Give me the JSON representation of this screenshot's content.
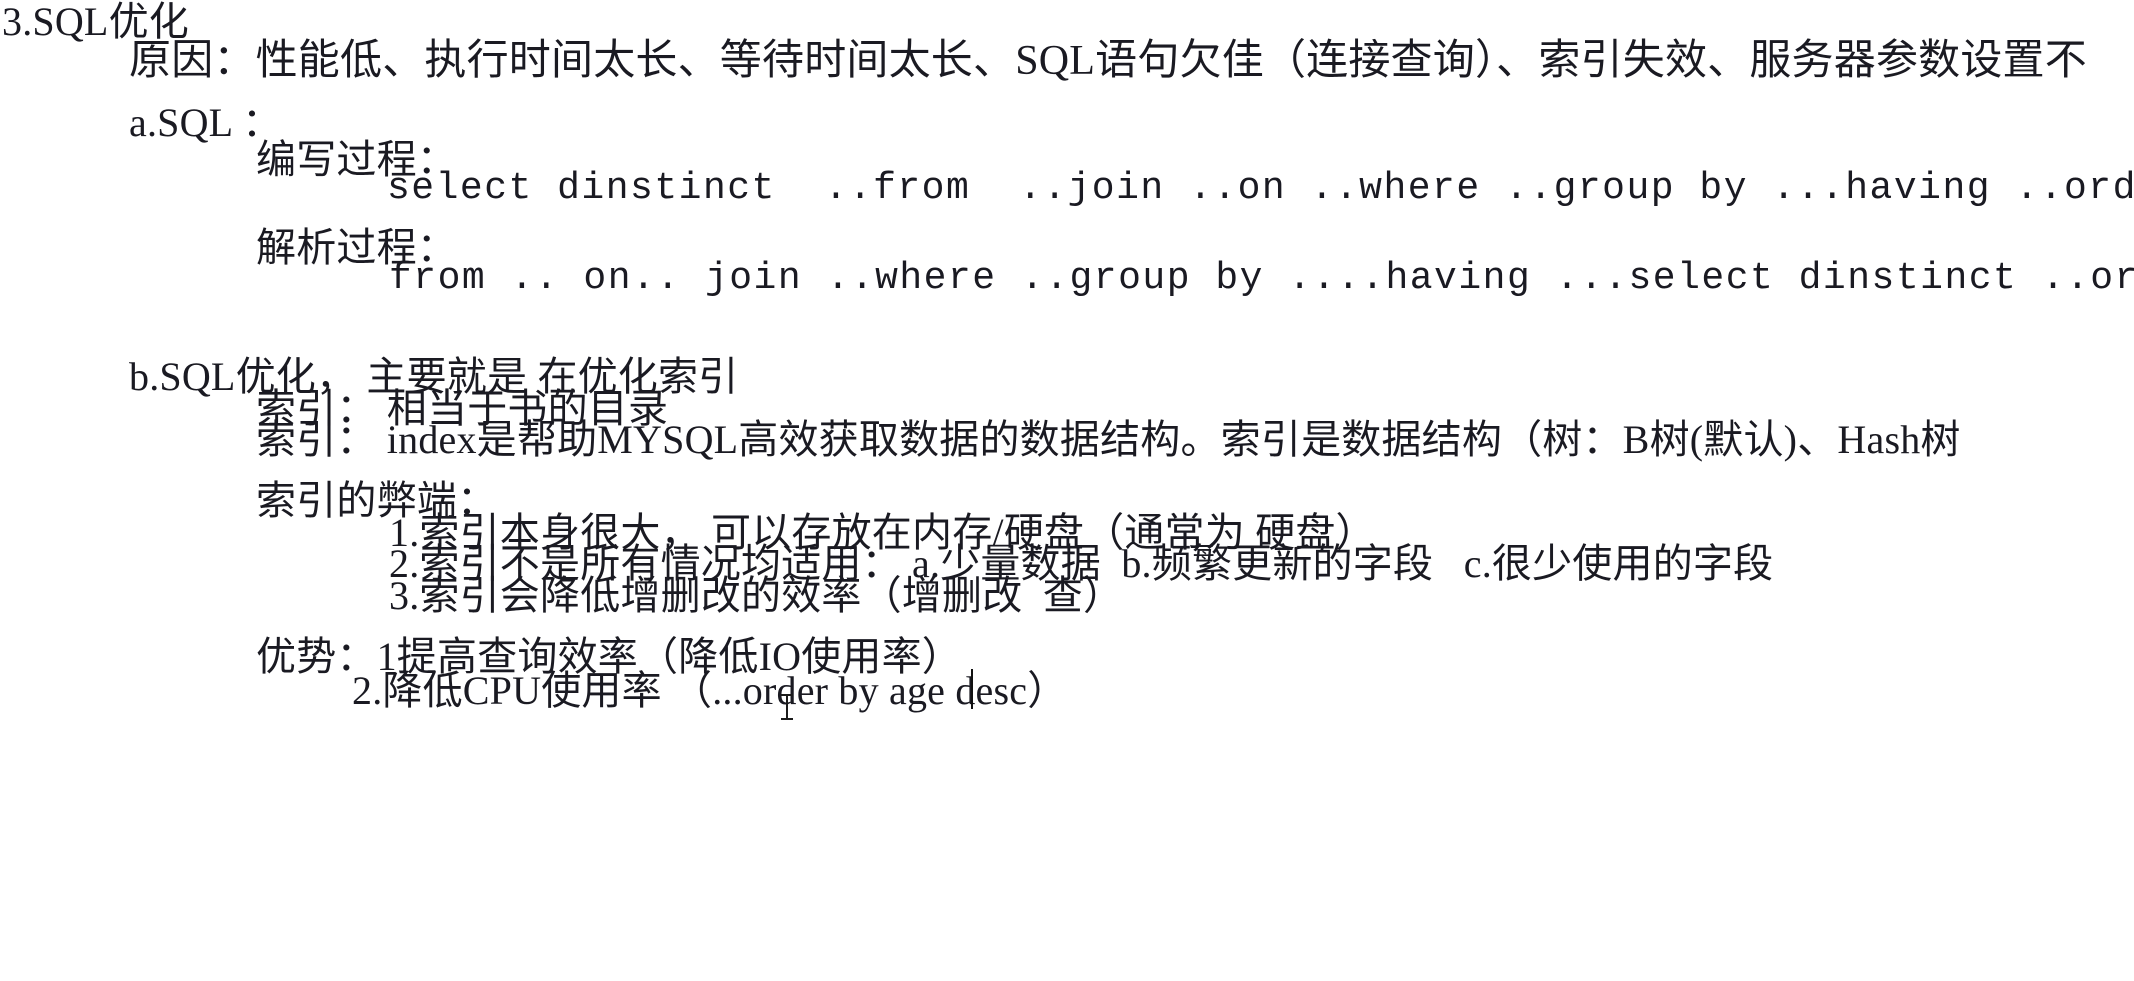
{
  "document": {
    "title_line": "3.SQL优化",
    "reason_line": "原因：性能低、执行时间太长、等待时间太长、SQL语句欠佳（连接查询）、索引失效、服务器参数设置不",
    "section_a": {
      "heading": "a.SQL ：",
      "writing_process_label": "编写过程：",
      "writing_process_code": "select dinstinct  ..from  ..join ..on ..where ..group by ...having ..orde",
      "parse_process_label": "解析过程：",
      "parse_process_code": "from .. on.. join ..where ..group by ....having ...select dinstinct ..ord"
    },
    "section_b": {
      "heading": "b.SQL优化， 主要就是 在优化索引",
      "index_def_simple": "索引： 相当于书的目录",
      "index_def_full": "索引： index是帮助MYSQL高效获取数据的数据结构。索引是数据结构（树：B树(默认)、Hash树",
      "drawbacks_heading": "索引的弊端：",
      "drawbacks": [
        "1.索引本身很大， 可以存放在内存/硬盘（通常为 硬盘）",
        "2.索引不是所有情况均适用： a.少量数据  b.频繁更新的字段   c.很少使用的字段",
        "3.索引会降低增删改的效率（增删改  查）"
      ],
      "advantages_heading": "优势：1提高查询效率（降低IO使用率）",
      "advantages_second": "2.降低CPU使用率 （...order by age desc）"
    }
  },
  "cursor": {
    "text_caret_label": "text-caret",
    "mouse_pointer_label": "i-beam-pointer"
  },
  "colors": {
    "page_background": "#ffffff",
    "text": "#1a1a22",
    "caret": "#111111"
  }
}
